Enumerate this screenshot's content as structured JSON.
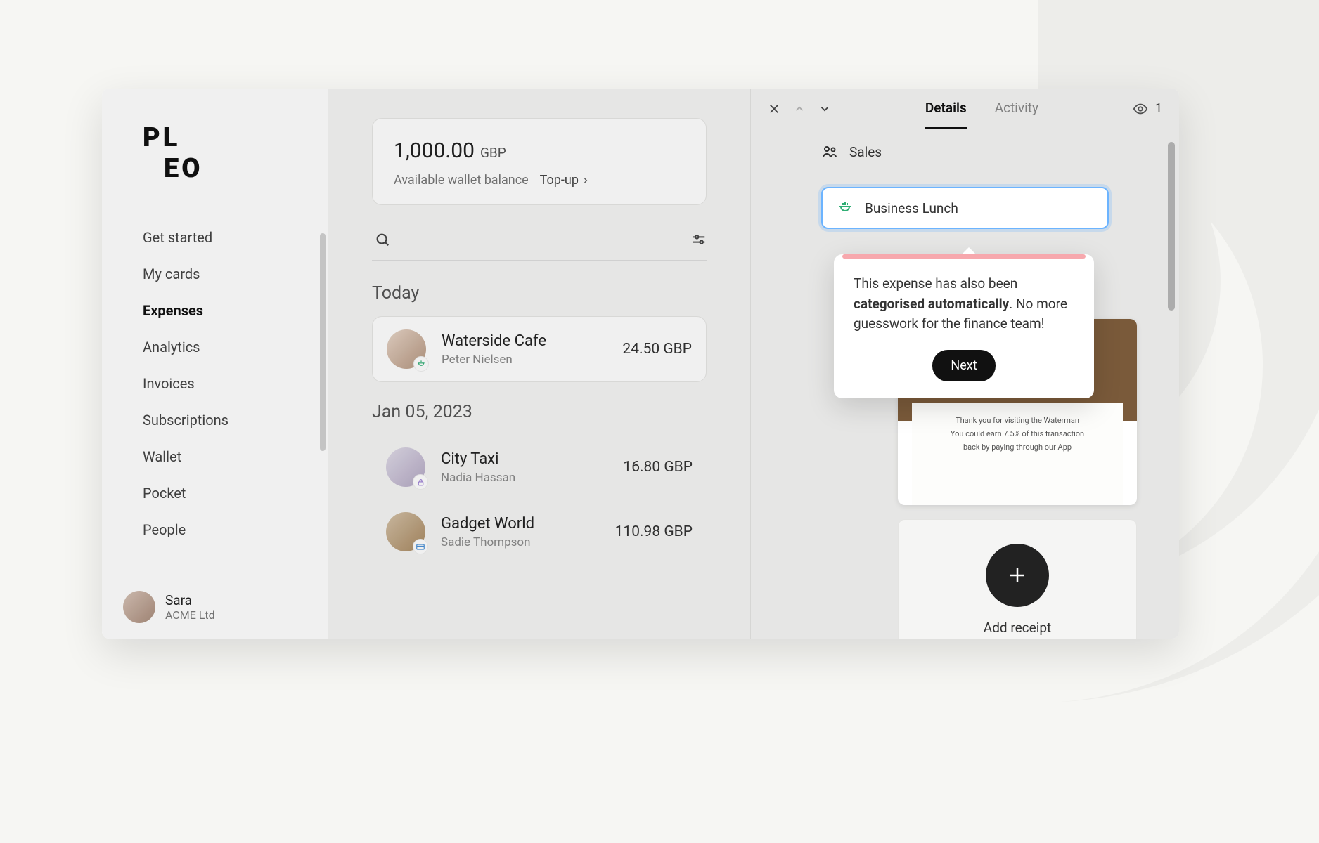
{
  "brand": "PLEO",
  "sidebar": {
    "items": [
      {
        "label": "Get started"
      },
      {
        "label": "My cards"
      },
      {
        "label": "Expenses"
      },
      {
        "label": "Analytics"
      },
      {
        "label": "Invoices"
      },
      {
        "label": "Subscriptions"
      },
      {
        "label": "Wallet"
      },
      {
        "label": "Pocket"
      },
      {
        "label": "People"
      }
    ],
    "active_index": 2,
    "footer": {
      "name": "Sara",
      "org": "ACME Ltd"
    }
  },
  "wallet": {
    "amount": "1,000.00",
    "currency": "GBP",
    "balance_label": "Available wallet balance",
    "topup_label": "Top-up"
  },
  "expenses": {
    "groups": [
      {
        "date": "Today",
        "rows": [
          {
            "merchant": "Waterside Cafe",
            "user": "Peter Nielsen",
            "amount": "24.50 GBP",
            "selected": true,
            "badge": "meal"
          }
        ]
      },
      {
        "date": "Jan 05, 2023",
        "rows": [
          {
            "merchant": "City Taxi",
            "user": "Nadia Hassan",
            "amount": "16.80 GBP",
            "selected": false,
            "badge": "lock"
          },
          {
            "merchant": "Gadget World",
            "user": "Sadie Thompson",
            "amount": "110.98 GBP",
            "selected": false,
            "badge": "card"
          }
        ]
      }
    ]
  },
  "detail": {
    "tabs": {
      "details": "Details",
      "activity": "Activity"
    },
    "watch_count": "1",
    "department": "Sales",
    "category": "Business Lunch",
    "tooltip": {
      "pre": "This expense has also been ",
      "bold": "categorised automatically",
      "post": ". No more guesswork for the finance team!",
      "button": "Next"
    },
    "receipt": {
      "line1": "Thank you for visiting the Waterman",
      "line2": "You could earn 7.5% of this transaction",
      "line3": "back by paying through our App"
    },
    "add_receipt_label": "Add receipt"
  }
}
